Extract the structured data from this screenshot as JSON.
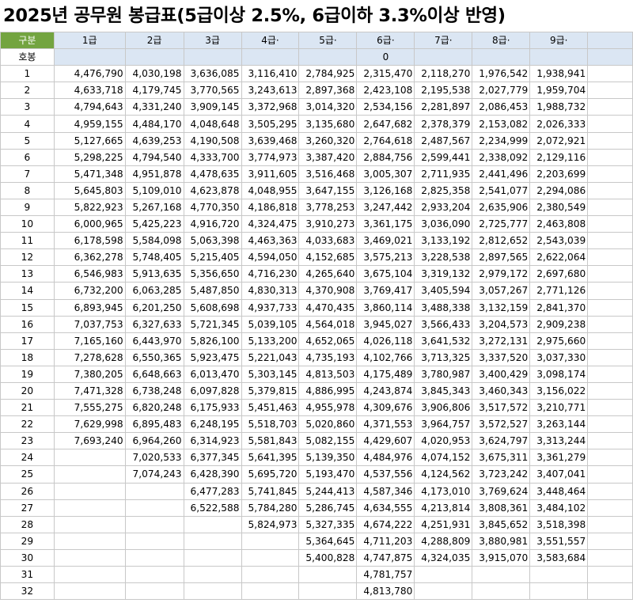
{
  "title": "2025년 공무원 봉급표(5급이상 2.5%, 6급이하 3.3%이상 반영)",
  "header": {
    "corner": "구분",
    "grades": [
      "1급",
      "2급",
      "3급",
      "4급·",
      "5급·",
      "6급·",
      "7급·",
      "8급·",
      "9급·"
    ]
  },
  "subheader": {
    "label": "호봉",
    "cells": [
      "",
      "",
      "",
      "",
      "",
      "0",
      "",
      "",
      ""
    ]
  },
  "rows": [
    [
      "1",
      "4,476,790",
      "4,030,198",
      "3,636,085",
      "3,116,410",
      "2,784,925",
      "2,315,470",
      "2,118,270",
      "1,976,542",
      "1,938,941"
    ],
    [
      "2",
      "4,633,718",
      "4,179,745",
      "3,770,565",
      "3,243,613",
      "2,897,368",
      "2,423,108",
      "2,195,538",
      "2,027,779",
      "1,959,704"
    ],
    [
      "3",
      "4,794,643",
      "4,331,240",
      "3,909,145",
      "3,372,968",
      "3,014,320",
      "2,534,156",
      "2,281,897",
      "2,086,453",
      "1,988,732"
    ],
    [
      "4",
      "4,959,155",
      "4,484,170",
      "4,048,648",
      "3,505,295",
      "3,135,680",
      "2,647,682",
      "2,378,379",
      "2,153,082",
      "2,026,333"
    ],
    [
      "5",
      "5,127,665",
      "4,639,253",
      "4,190,508",
      "3,639,468",
      "3,260,320",
      "2,764,618",
      "2,487,567",
      "2,234,999",
      "2,072,921"
    ],
    [
      "6",
      "5,298,225",
      "4,794,540",
      "4,333,700",
      "3,774,973",
      "3,387,420",
      "2,884,756",
      "2,599,441",
      "2,338,092",
      "2,129,116"
    ],
    [
      "7",
      "5,471,348",
      "4,951,878",
      "4,478,635",
      "3,911,605",
      "3,516,468",
      "3,005,307",
      "2,711,935",
      "2,441,496",
      "2,203,699"
    ],
    [
      "8",
      "5,645,803",
      "5,109,010",
      "4,623,878",
      "4,048,955",
      "3,647,155",
      "3,126,168",
      "2,825,358",
      "2,541,077",
      "2,294,086"
    ],
    [
      "9",
      "5,822,923",
      "5,267,168",
      "4,770,350",
      "4,186,818",
      "3,778,253",
      "3,247,442",
      "2,933,204",
      "2,635,906",
      "2,380,549"
    ],
    [
      "10",
      "6,000,965",
      "5,425,223",
      "4,916,720",
      "4,324,475",
      "3,910,273",
      "3,361,175",
      "3,036,090",
      "2,725,777",
      "2,463,808"
    ],
    [
      "11",
      "6,178,598",
      "5,584,098",
      "5,063,398",
      "4,463,363",
      "4,033,683",
      "3,469,021",
      "3,133,192",
      "2,812,652",
      "2,543,039"
    ],
    [
      "12",
      "6,362,278",
      "5,748,405",
      "5,215,405",
      "4,594,050",
      "4,152,685",
      "3,575,213",
      "3,228,538",
      "2,897,565",
      "2,622,064"
    ],
    [
      "13",
      "6,546,983",
      "5,913,635",
      "5,356,650",
      "4,716,230",
      "4,265,640",
      "3,675,104",
      "3,319,132",
      "2,979,172",
      "2,697,680"
    ],
    [
      "14",
      "6,732,200",
      "6,063,285",
      "5,487,850",
      "4,830,313",
      "4,370,908",
      "3,769,417",
      "3,405,594",
      "3,057,267",
      "2,771,126"
    ],
    [
      "15",
      "6,893,945",
      "6,201,250",
      "5,608,698",
      "4,937,733",
      "4,470,435",
      "3,860,114",
      "3,488,338",
      "3,132,159",
      "2,841,370"
    ],
    [
      "16",
      "7,037,753",
      "6,327,633",
      "5,721,345",
      "5,039,105",
      "4,564,018",
      "3,945,027",
      "3,566,433",
      "3,204,573",
      "2,909,238"
    ],
    [
      "17",
      "7,165,160",
      "6,443,970",
      "5,826,100",
      "5,133,200",
      "4,652,065",
      "4,026,118",
      "3,641,532",
      "3,272,131",
      "2,975,660"
    ],
    [
      "18",
      "7,278,628",
      "6,550,365",
      "5,923,475",
      "5,221,043",
      "4,735,193",
      "4,102,766",
      "3,713,325",
      "3,337,520",
      "3,037,330"
    ],
    [
      "19",
      "7,380,205",
      "6,648,663",
      "6,013,470",
      "5,303,145",
      "4,813,503",
      "4,175,489",
      "3,780,987",
      "3,400,429",
      "3,098,174"
    ],
    [
      "20",
      "7,471,328",
      "6,738,248",
      "6,097,828",
      "5,379,815",
      "4,886,995",
      "4,243,874",
      "3,845,343",
      "3,460,343",
      "3,156,022"
    ],
    [
      "21",
      "7,555,275",
      "6,820,248",
      "6,175,933",
      "5,451,463",
      "4,955,978",
      "4,309,676",
      "3,906,806",
      "3,517,572",
      "3,210,771"
    ],
    [
      "22",
      "7,629,998",
      "6,895,483",
      "6,248,195",
      "5,518,703",
      "5,020,860",
      "4,371,553",
      "3,964,757",
      "3,572,527",
      "3,263,144"
    ],
    [
      "23",
      "7,693,240",
      "6,964,260",
      "6,314,923",
      "5,581,843",
      "5,082,155",
      "4,429,607",
      "4,020,953",
      "3,624,797",
      "3,313,244"
    ],
    [
      "24",
      "",
      "7,020,533",
      "6,377,345",
      "5,641,395",
      "5,139,350",
      "4,484,976",
      "4,074,152",
      "3,675,311",
      "3,361,279"
    ],
    [
      "25",
      "",
      "7,074,243",
      "6,428,390",
      "5,695,720",
      "5,193,470",
      "4,537,556",
      "4,124,562",
      "3,723,242",
      "3,407,041"
    ],
    [
      "26",
      "",
      "",
      "6,477,283",
      "5,741,845",
      "5,244,413",
      "4,587,346",
      "4,173,010",
      "3,769,624",
      "3,448,464"
    ],
    [
      "27",
      "",
      "",
      "6,522,588",
      "5,784,280",
      "5,286,745",
      "4,634,555",
      "4,213,814",
      "3,808,361",
      "3,484,102"
    ],
    [
      "28",
      "",
      "",
      "",
      "5,824,973",
      "5,327,335",
      "4,674,222",
      "4,251,931",
      "3,845,652",
      "3,518,398"
    ],
    [
      "29",
      "",
      "",
      "",
      "",
      "5,364,645",
      "4,711,203",
      "4,288,809",
      "3,880,981",
      "3,551,557"
    ],
    [
      "30",
      "",
      "",
      "",
      "",
      "5,400,828",
      "4,747,875",
      "4,324,035",
      "3,915,070",
      "3,583,684"
    ],
    [
      "31",
      "",
      "",
      "",
      "",
      "",
      "4,781,757",
      "",
      "",
      ""
    ],
    [
      "32",
      "",
      "",
      "",
      "",
      "",
      "4,813,780",
      "",
      "",
      ""
    ]
  ],
  "colors": {
    "corner_bg": "#73a440",
    "header_bg": "#dbe6f3",
    "grid": "#c8c8c8"
  }
}
